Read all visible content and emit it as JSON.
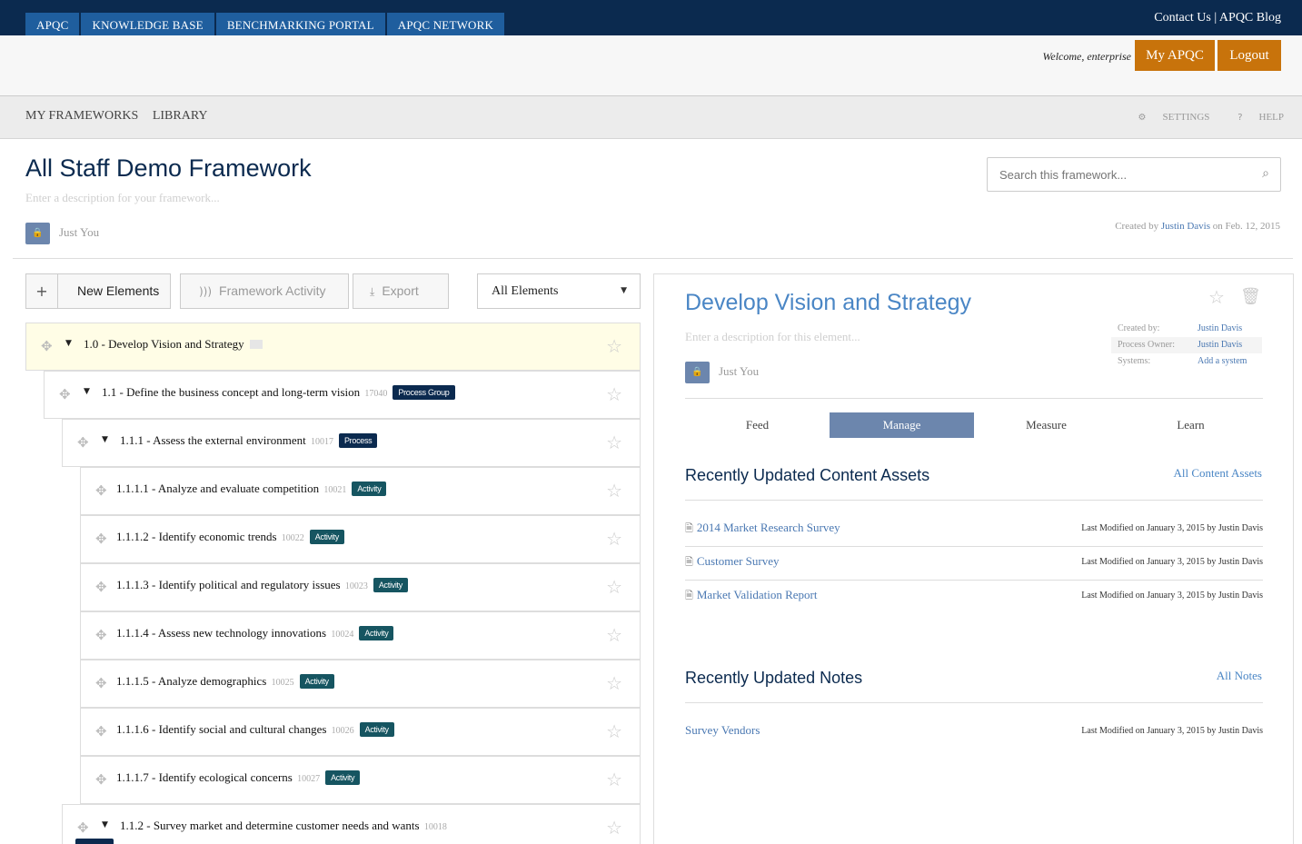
{
  "top_nav": {
    "tabs": [
      "APQC",
      "KNOWLEDGE BASE",
      "BENCHMARKING PORTAL",
      "APQC NETWORK"
    ]
  },
  "top_links": {
    "contact": "Contact Us",
    "separator": "|",
    "blog": "APQC Blog"
  },
  "account": {
    "welcome": "Welcome, enterprise",
    "my_apqc": "My APQC",
    "logout": "Logout"
  },
  "sub_nav": {
    "my_frameworks": "MY FRAMEWORKS",
    "library": "LIBRARY",
    "settings": "SETTINGS",
    "help": "HELP"
  },
  "framework": {
    "title": "All Staff Demo Framework",
    "description_placeholder": "Enter a description for your framework...",
    "visibility": "Just You",
    "search_placeholder": "Search this framework...",
    "created_prefix": "Created by",
    "created_by": "Justin Davis",
    "created_suffix": "on Feb. 12, 2015"
  },
  "toolbar": {
    "new_elements": "New Elements",
    "framework_activity": "Framework Activity",
    "export": "Export",
    "filter_value": "All Elements"
  },
  "tree": [
    {
      "label": "1.0 - Develop Vision and Strategy",
      "id": "",
      "badge": ""
    },
    {
      "label": "1.1 - Define the business concept and long-term vision",
      "id": "17040",
      "badge": "Process Group"
    },
    {
      "label": "1.1.1 - Assess the external environment",
      "id": "10017",
      "badge": "Process"
    },
    {
      "label": "1.1.1.1 - Analyze and evaluate competition",
      "id": "10021",
      "badge": "Activity"
    },
    {
      "label": "1.1.1.2 - Identify economic trends",
      "id": "10022",
      "badge": "Activity"
    },
    {
      "label": "1.1.1.3 - Identify political and regulatory issues",
      "id": "10023",
      "badge": "Activity"
    },
    {
      "label": "1.1.1.4 - Assess new technology innovations",
      "id": "10024",
      "badge": "Activity"
    },
    {
      "label": "1.1.1.5 - Analyze demographics",
      "id": "10025",
      "badge": "Activity"
    },
    {
      "label": "1.1.1.6 - Identify social and cultural changes",
      "id": "10026",
      "badge": "Activity"
    },
    {
      "label": "1.1.1.7 - Identify ecological concerns",
      "id": "10027",
      "badge": "Activity"
    },
    {
      "label": "1.1.2 - Survey market and determine customer needs and wants",
      "id": "10018",
      "badge": ""
    }
  ],
  "element": {
    "title": "Develop Vision and Strategy",
    "description_placeholder": "Enter a description for this element...",
    "visibility": "Just You",
    "meta": [
      {
        "key": "Created by:",
        "value": "Justin Davis"
      },
      {
        "key": "Process Owner:",
        "value": "Justin Davis"
      },
      {
        "key": "Systems:",
        "value": "Add a system"
      }
    ],
    "tabs": [
      "Feed",
      "Manage",
      "Measure",
      "Learn"
    ],
    "active_tab": "Manage"
  },
  "content_assets": {
    "title": "Recently Updated Content Assets",
    "link": "All Content Assets",
    "items": [
      {
        "name": "2014 Market Research Survey",
        "modified": "Last Modified on January 3, 2015 by Justin Davis",
        "file_icon": "pdf-file-icon"
      },
      {
        "name": "Customer Survey",
        "modified": "Last Modified on January 3, 2015 by Justin Davis",
        "file_icon": "word-file-icon"
      },
      {
        "name": "Market Validation Report",
        "modified": "Last Modified on January 3, 2015 by Justin Davis",
        "file_icon": "excel-file-icon"
      }
    ]
  },
  "notes": {
    "title": "Recently Updated Notes",
    "link": "All Notes",
    "items": [
      {
        "name": "Survey Vendors",
        "modified": "Last Modified on January 3, 2015 by Justin Davis"
      }
    ]
  },
  "colors": {
    "navy": "#0b2a4f",
    "tab_blue": "#1f5e9e",
    "orange": "#c8730b",
    "accent": "#6c86ad",
    "link": "#4a86c5"
  }
}
